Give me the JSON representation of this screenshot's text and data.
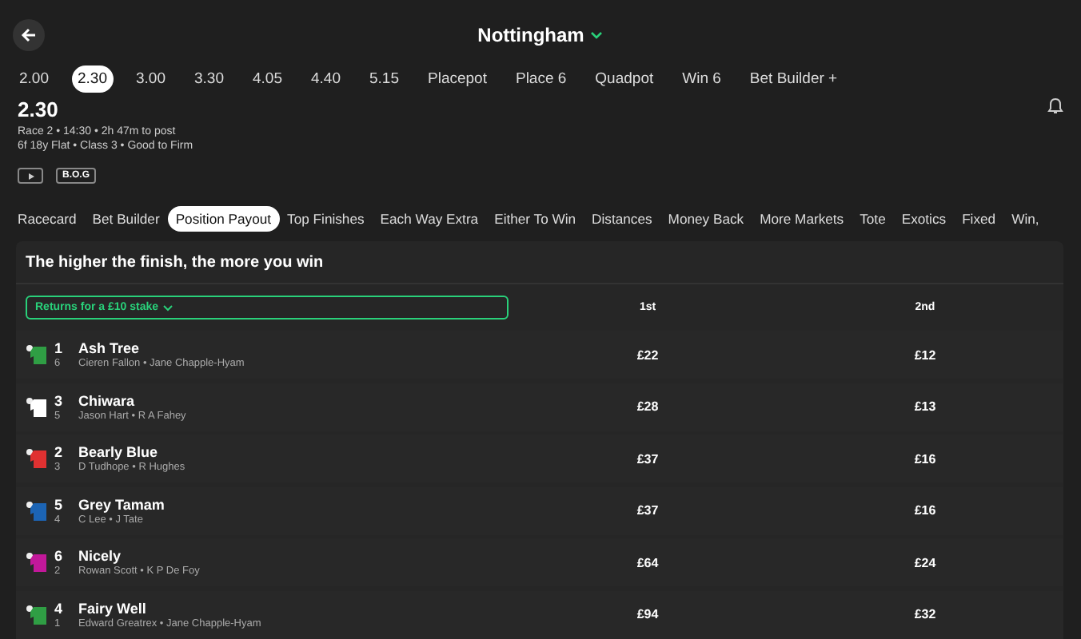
{
  "header": {
    "title": "Nottingham"
  },
  "race_tabs": [
    {
      "label": "2.00",
      "selected": false
    },
    {
      "label": "2.30",
      "selected": true
    },
    {
      "label": "3.00",
      "selected": false
    },
    {
      "label": "3.30",
      "selected": false
    },
    {
      "label": "4.05",
      "selected": false
    },
    {
      "label": "4.40",
      "selected": false
    },
    {
      "label": "5.15",
      "selected": false
    },
    {
      "label": "Placepot",
      "selected": false
    },
    {
      "label": "Place 6",
      "selected": false
    },
    {
      "label": "Quadpot",
      "selected": false
    },
    {
      "label": "Win 6",
      "selected": false
    },
    {
      "label": "Bet Builder +",
      "selected": false
    }
  ],
  "race": {
    "time": "2.30",
    "info": "Race 2 • 14:30 • 2h 47m to post",
    "details": "6f 18y Flat  • Class 3  • Good to Firm",
    "badge": "B.O.G"
  },
  "market_tabs": [
    {
      "label": "Racecard",
      "selected": false
    },
    {
      "label": "Bet Builder",
      "selected": false
    },
    {
      "label": "Position Payout",
      "selected": true
    },
    {
      "label": "Top Finishes",
      "selected": false
    },
    {
      "label": "Each Way Extra",
      "selected": false
    },
    {
      "label": "Either To Win",
      "selected": false
    },
    {
      "label": "Distances",
      "selected": false
    },
    {
      "label": "Money Back",
      "selected": false
    },
    {
      "label": "More Markets",
      "selected": false
    },
    {
      "label": "Tote",
      "selected": false
    },
    {
      "label": "Exotics",
      "selected": false
    },
    {
      "label": "Fixed",
      "selected": false
    },
    {
      "label": "Win,",
      "selected": false
    }
  ],
  "panel": {
    "heading": "The higher the finish, the more you win",
    "stake_dropdown": "Returns for a £10 stake",
    "columns": [
      "1st",
      "2nd"
    ],
    "runners": [
      {
        "number": "1",
        "draw": "6",
        "name": "Ash Tree",
        "connections": "Cieren Fallon • Jane Chapple-Hyam",
        "color": "#2f9e44",
        "payouts": [
          "£22",
          "£12"
        ]
      },
      {
        "number": "3",
        "draw": "5",
        "name": "Chiwara",
        "connections": "Jason Hart • R A Fahey",
        "color": "#ffffff",
        "payouts": [
          "£28",
          "£13"
        ]
      },
      {
        "number": "2",
        "draw": "3",
        "name": "Bearly Blue",
        "connections": "D Tudhope • R Hughes",
        "color": "#e03131",
        "payouts": [
          "£37",
          "£16"
        ]
      },
      {
        "number": "5",
        "draw": "4",
        "name": "Grey Tamam",
        "connections": "C Lee • J Tate",
        "color": "#1c64b4",
        "payouts": [
          "£37",
          "£16"
        ]
      },
      {
        "number": "6",
        "draw": "2",
        "name": "Nicely",
        "connections": "Rowan Scott • K P De Foy",
        "color": "#c2189a",
        "payouts": [
          "£64",
          "£24"
        ]
      },
      {
        "number": "4",
        "draw": "1",
        "name": "Fairy Well",
        "connections": "Edward Greatrex • Jane Chapple-Hyam",
        "color": "#2f9e44",
        "payouts": [
          "£94",
          "£32"
        ]
      }
    ]
  }
}
